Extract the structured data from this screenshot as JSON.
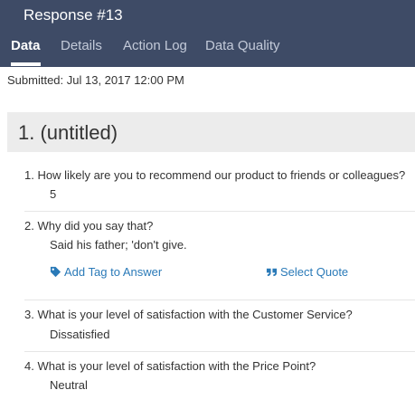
{
  "header": {
    "title": "Response #13",
    "tabs": [
      {
        "label": "Data",
        "active": true
      },
      {
        "label": "Details",
        "active": false
      },
      {
        "label": "Action Log",
        "active": false
      },
      {
        "label": "Data Quality",
        "active": false
      }
    ]
  },
  "submitted": "Submitted: Jul 13, 2017 12:00 PM",
  "section": {
    "title": "1. (untitled)"
  },
  "questions": [
    {
      "question": "1. How likely are you to recommend our product to friends or colleagues?",
      "answer": "5"
    },
    {
      "question": "2. Why did you say that?",
      "answer": "Said his father; 'don't give."
    },
    {
      "question": "3. What is your level of satisfaction with the Customer Service?",
      "answer": "Dissatisfied"
    },
    {
      "question": "4. What is your level of satisfaction with the Price Point?",
      "answer": "Neutral"
    }
  ],
  "actions": {
    "add_tag": "Add Tag to Answer",
    "select_quote": "Select Quote"
  },
  "colors": {
    "header_bg": "#3e4b66",
    "link": "#2a7ab8",
    "section_bg": "#ececec"
  },
  "icons": {
    "add_tag": "tag-icon",
    "select_quote": "quote-icon"
  }
}
